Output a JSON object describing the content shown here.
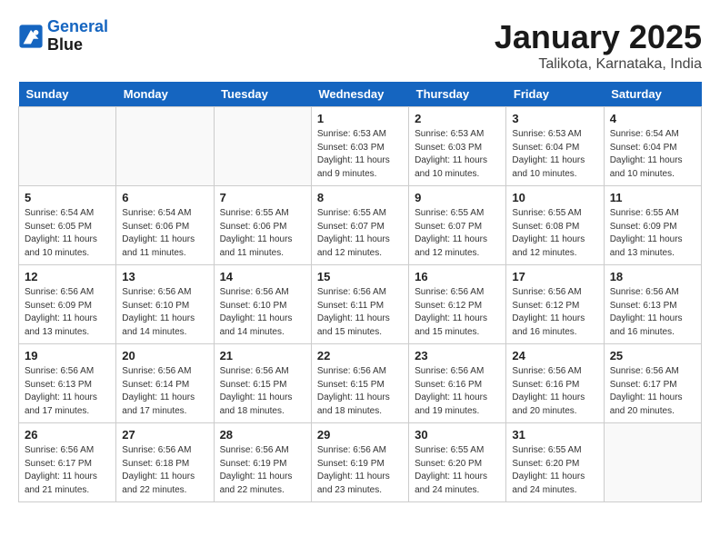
{
  "header": {
    "logo_line1": "General",
    "logo_line2": "Blue",
    "month": "January 2025",
    "location": "Talikota, Karnataka, India"
  },
  "weekdays": [
    "Sunday",
    "Monday",
    "Tuesday",
    "Wednesday",
    "Thursday",
    "Friday",
    "Saturday"
  ],
  "weeks": [
    [
      {
        "day": "",
        "info": ""
      },
      {
        "day": "",
        "info": ""
      },
      {
        "day": "",
        "info": ""
      },
      {
        "day": "1",
        "info": "Sunrise: 6:53 AM\nSunset: 6:03 PM\nDaylight: 11 hours\nand 9 minutes."
      },
      {
        "day": "2",
        "info": "Sunrise: 6:53 AM\nSunset: 6:03 PM\nDaylight: 11 hours\nand 10 minutes."
      },
      {
        "day": "3",
        "info": "Sunrise: 6:53 AM\nSunset: 6:04 PM\nDaylight: 11 hours\nand 10 minutes."
      },
      {
        "day": "4",
        "info": "Sunrise: 6:54 AM\nSunset: 6:04 PM\nDaylight: 11 hours\nand 10 minutes."
      }
    ],
    [
      {
        "day": "5",
        "info": "Sunrise: 6:54 AM\nSunset: 6:05 PM\nDaylight: 11 hours\nand 10 minutes."
      },
      {
        "day": "6",
        "info": "Sunrise: 6:54 AM\nSunset: 6:06 PM\nDaylight: 11 hours\nand 11 minutes."
      },
      {
        "day": "7",
        "info": "Sunrise: 6:55 AM\nSunset: 6:06 PM\nDaylight: 11 hours\nand 11 minutes."
      },
      {
        "day": "8",
        "info": "Sunrise: 6:55 AM\nSunset: 6:07 PM\nDaylight: 11 hours\nand 12 minutes."
      },
      {
        "day": "9",
        "info": "Sunrise: 6:55 AM\nSunset: 6:07 PM\nDaylight: 11 hours\nand 12 minutes."
      },
      {
        "day": "10",
        "info": "Sunrise: 6:55 AM\nSunset: 6:08 PM\nDaylight: 11 hours\nand 12 minutes."
      },
      {
        "day": "11",
        "info": "Sunrise: 6:55 AM\nSunset: 6:09 PM\nDaylight: 11 hours\nand 13 minutes."
      }
    ],
    [
      {
        "day": "12",
        "info": "Sunrise: 6:56 AM\nSunset: 6:09 PM\nDaylight: 11 hours\nand 13 minutes."
      },
      {
        "day": "13",
        "info": "Sunrise: 6:56 AM\nSunset: 6:10 PM\nDaylight: 11 hours\nand 14 minutes."
      },
      {
        "day": "14",
        "info": "Sunrise: 6:56 AM\nSunset: 6:10 PM\nDaylight: 11 hours\nand 14 minutes."
      },
      {
        "day": "15",
        "info": "Sunrise: 6:56 AM\nSunset: 6:11 PM\nDaylight: 11 hours\nand 15 minutes."
      },
      {
        "day": "16",
        "info": "Sunrise: 6:56 AM\nSunset: 6:12 PM\nDaylight: 11 hours\nand 15 minutes."
      },
      {
        "day": "17",
        "info": "Sunrise: 6:56 AM\nSunset: 6:12 PM\nDaylight: 11 hours\nand 16 minutes."
      },
      {
        "day": "18",
        "info": "Sunrise: 6:56 AM\nSunset: 6:13 PM\nDaylight: 11 hours\nand 16 minutes."
      }
    ],
    [
      {
        "day": "19",
        "info": "Sunrise: 6:56 AM\nSunset: 6:13 PM\nDaylight: 11 hours\nand 17 minutes."
      },
      {
        "day": "20",
        "info": "Sunrise: 6:56 AM\nSunset: 6:14 PM\nDaylight: 11 hours\nand 17 minutes."
      },
      {
        "day": "21",
        "info": "Sunrise: 6:56 AM\nSunset: 6:15 PM\nDaylight: 11 hours\nand 18 minutes."
      },
      {
        "day": "22",
        "info": "Sunrise: 6:56 AM\nSunset: 6:15 PM\nDaylight: 11 hours\nand 18 minutes."
      },
      {
        "day": "23",
        "info": "Sunrise: 6:56 AM\nSunset: 6:16 PM\nDaylight: 11 hours\nand 19 minutes."
      },
      {
        "day": "24",
        "info": "Sunrise: 6:56 AM\nSunset: 6:16 PM\nDaylight: 11 hours\nand 20 minutes."
      },
      {
        "day": "25",
        "info": "Sunrise: 6:56 AM\nSunset: 6:17 PM\nDaylight: 11 hours\nand 20 minutes."
      }
    ],
    [
      {
        "day": "26",
        "info": "Sunrise: 6:56 AM\nSunset: 6:17 PM\nDaylight: 11 hours\nand 21 minutes."
      },
      {
        "day": "27",
        "info": "Sunrise: 6:56 AM\nSunset: 6:18 PM\nDaylight: 11 hours\nand 22 minutes."
      },
      {
        "day": "28",
        "info": "Sunrise: 6:56 AM\nSunset: 6:19 PM\nDaylight: 11 hours\nand 22 minutes."
      },
      {
        "day": "29",
        "info": "Sunrise: 6:56 AM\nSunset: 6:19 PM\nDaylight: 11 hours\nand 23 minutes."
      },
      {
        "day": "30",
        "info": "Sunrise: 6:55 AM\nSunset: 6:20 PM\nDaylight: 11 hours\nand 24 minutes."
      },
      {
        "day": "31",
        "info": "Sunrise: 6:55 AM\nSunset: 6:20 PM\nDaylight: 11 hours\nand 24 minutes."
      },
      {
        "day": "",
        "info": ""
      }
    ]
  ]
}
